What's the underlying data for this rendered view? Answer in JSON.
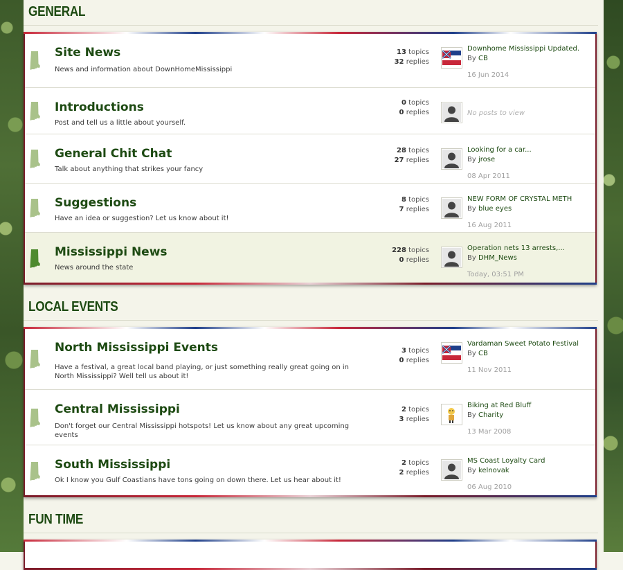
{
  "categories": [
    {
      "title": "GENERAL",
      "forums": [
        {
          "name": "Site News",
          "desc": "News and information about DownHomeMississippi",
          "topics": "13",
          "replies": "32",
          "last_title": "Downhome Mississippi Updated.",
          "last_by": "CB",
          "last_date": "16 Jun 2014",
          "avatar": "ms-flag-icon"
        },
        {
          "name": "Introductions",
          "desc": "Post and tell us a little about yourself.",
          "topics": "0",
          "replies": "0",
          "last_title": "",
          "last_by": "",
          "last_date": "",
          "none": "No posts to view",
          "avatar": "default-avatar-icon"
        },
        {
          "name": "General Chit Chat",
          "desc": "Talk about anything that strikes your fancy",
          "topics": "28",
          "replies": "27",
          "last_title": "Looking for a car...",
          "last_by": "jrose",
          "last_date": "08 Apr 2011",
          "avatar": "default-avatar-icon"
        },
        {
          "name": "Suggestions",
          "desc": "Have an idea or suggestion? Let us know about it!",
          "topics": "8",
          "replies": "7",
          "last_title": "NEW FORM OF CRYSTAL METH",
          "last_by": "blue eyes",
          "last_date": "16 Aug 2011",
          "avatar": "default-avatar-icon"
        },
        {
          "name": "Mississippi News",
          "desc": "News around the state",
          "topics": "228",
          "replies": "0",
          "last_title": "Operation nets 13 arrests,...",
          "last_by": "DHM_News",
          "last_date": "Today, 03:51 PM",
          "avatar": "default-avatar-icon",
          "unread": true
        }
      ]
    },
    {
      "title": "LOCAL EVENTS",
      "forums": [
        {
          "name": "North Mississippi Events",
          "desc": "Have a festival, a great local band playing, or just something really great going on in North Mississippi? Well tell us about it!",
          "topics": "3",
          "replies": "0",
          "last_title": "Vardaman Sweet Potato Festival",
          "last_by": "CB",
          "last_date": "11 Nov 2011",
          "avatar": "ms-flag-icon"
        },
        {
          "name": "Central Mississippi",
          "desc": "Don't forget our Central Mississippi hotspots! Let us know about any great upcoming events",
          "topics": "2",
          "replies": "3",
          "last_title": "Biking at Red Bluff",
          "last_by": "Charity",
          "last_date": "13 Mar 2008",
          "avatar": "character-avatar-icon"
        },
        {
          "name": "South Mississippi",
          "desc": "Ok I know you Gulf Coastians have tons going on down there. Let us hear about it!",
          "topics": "2",
          "replies": "2",
          "last_title": "MS Coast Loyalty Card",
          "last_by": "kelnovak",
          "last_date": "06 Aug 2010",
          "avatar": "default-avatar-icon"
        }
      ]
    },
    {
      "title": "FUN TIME",
      "forums": []
    }
  ],
  "labels": {
    "topics": "topics",
    "replies": "replies",
    "by": "By"
  },
  "colors": {
    "accent": "#1d4a12",
    "border": "#7a1c2a",
    "state_read": "#a9c28a",
    "state_unread": "#4e8a2e"
  }
}
